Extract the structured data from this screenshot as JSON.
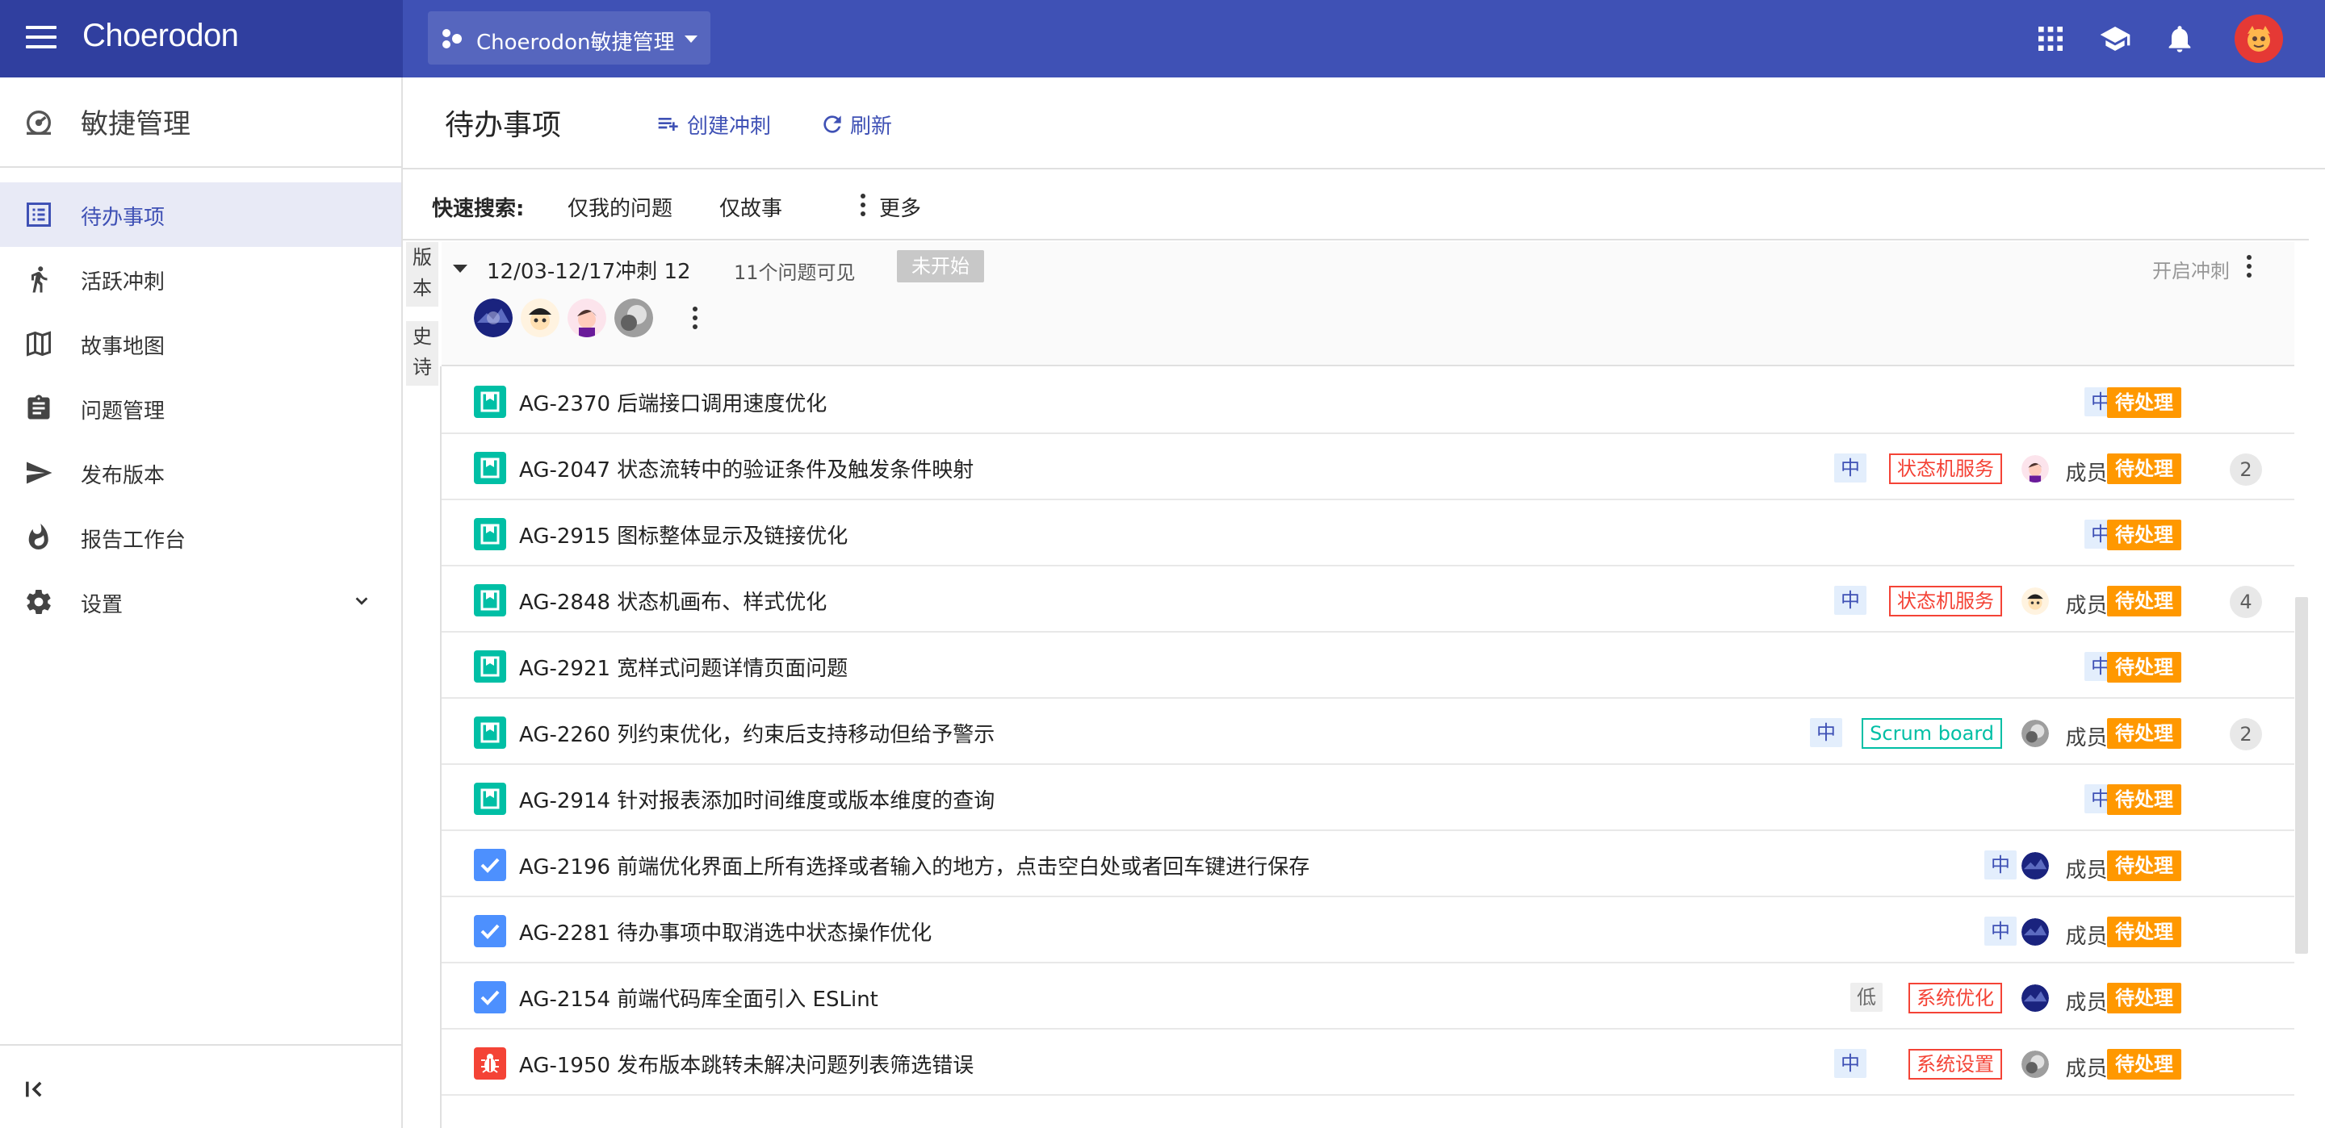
{
  "topbar": {
    "brand": "Choerodon",
    "project": "Choerodon敏捷管理",
    "icons": [
      "menu-icon",
      "apps-icon",
      "school-icon",
      "bell-icon",
      "user-avatar"
    ]
  },
  "sidebar": {
    "title": "敏捷管理",
    "items": [
      {
        "label": "待办事项",
        "icon": "list-icon"
      },
      {
        "label": "活跃冲刺",
        "icon": "run-icon"
      },
      {
        "label": "故事地图",
        "icon": "map-icon"
      },
      {
        "label": "问题管理",
        "icon": "clipboard-icon"
      },
      {
        "label": "发布版本",
        "icon": "send-icon"
      },
      {
        "label": "报告工作台",
        "icon": "fire-icon"
      },
      {
        "label": "设置",
        "icon": "gear-icon"
      }
    ]
  },
  "main": {
    "title": "待办事项",
    "create_sprint": "创建冲刺",
    "refresh": "刷新"
  },
  "quick_search": {
    "label": "快速搜索:",
    "items": [
      "仅我的问题",
      "仅故事"
    ],
    "more": "更多"
  },
  "side_tabs": [
    "版本",
    "史诗"
  ],
  "sprint": {
    "name": "12/03-12/17冲刺 12",
    "count": "11个问题可见",
    "status": "未开始",
    "start": "开启冲刺"
  },
  "issues": [
    {
      "key": "AG-2370",
      "title": "后端接口调用速度优化",
      "type": "story",
      "priority": "中",
      "component": "",
      "assignee": "",
      "status": "待处理",
      "points": ""
    },
    {
      "key": "AG-2047",
      "title": "状态流转中的验证条件及触发条件映射",
      "type": "story",
      "priority": "中",
      "component": "状态机服务",
      "assignee": "成员1",
      "status": "待处理",
      "points": "2"
    },
    {
      "key": "AG-2915",
      "title": "图标整体显示及链接优化",
      "type": "story",
      "priority": "中",
      "component": "",
      "assignee": "",
      "status": "待处理",
      "points": ""
    },
    {
      "key": "AG-2848",
      "title": "状态机画布、样式优化",
      "type": "story",
      "priority": "中",
      "component": "状态机服务",
      "assignee": "成员2",
      "status": "待处理",
      "points": "4"
    },
    {
      "key": "AG-2921",
      "title": "宽样式问题详情页面问题",
      "type": "story",
      "priority": "中",
      "component": "",
      "assignee": "",
      "status": "待处理",
      "points": ""
    },
    {
      "key": "AG-2260",
      "title": "列约束优化，约束后支持移动但给予警示",
      "type": "story",
      "priority": "中",
      "component": "Scrum board",
      "assignee": "成员3",
      "status": "待处理",
      "points": "2"
    },
    {
      "key": "AG-2914",
      "title": "针对报表添加时间维度或版本维度的查询",
      "type": "story",
      "priority": "中",
      "component": "",
      "assignee": "",
      "status": "待处理",
      "points": ""
    },
    {
      "key": "AG-2196",
      "title": "前端优化界面上所有选择或者输入的地方，点击空白处或者回车键进行保存",
      "type": "task",
      "priority": "中",
      "component": "",
      "assignee": "成员4",
      "status": "待处理",
      "points": ""
    },
    {
      "key": "AG-2281",
      "title": "待办事项中取消选中状态操作优化",
      "type": "task",
      "priority": "中",
      "component": "",
      "assignee": "成员4",
      "status": "待处理",
      "points": ""
    },
    {
      "key": "AG-2154",
      "title": "前端代码库全面引入 ESLint",
      "type": "task",
      "priority": "低",
      "component": "系统优化",
      "assignee": "成员4",
      "status": "待处理",
      "points": ""
    },
    {
      "key": "AG-1950",
      "title": "发布版本跳转未解决问题列表筛选错误",
      "type": "bug",
      "priority": "中",
      "component": "系统设置",
      "assignee": "成员3",
      "status": "待处理",
      "points": ""
    }
  ],
  "colors": {
    "primary": "#3f51b5",
    "primary_dark": "#303f9f",
    "story": "#00bfa5",
    "task": "#4d90fe",
    "bug": "#f44336",
    "status_todo": "#ff9800",
    "comp_red": "#f44336",
    "comp_green": "#00bfa5"
  }
}
